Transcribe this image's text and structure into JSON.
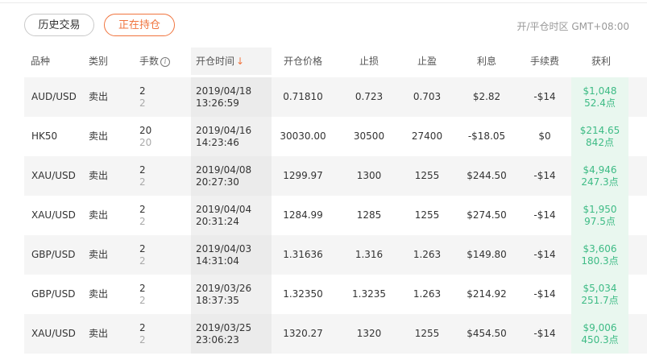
{
  "tabs": {
    "history": "历史交易",
    "open": "正在持仓"
  },
  "timezone": "开/平仓时区 GMT+08:00",
  "headers": {
    "symbol": "品种",
    "type": "类别",
    "lots": "手数",
    "open_time": "开仓时间",
    "open_price": "开仓价格",
    "stop_loss": "止损",
    "take_profit": "止盈",
    "interest": "利息",
    "commission": "手续费",
    "profit": "获利"
  },
  "colors": {
    "accent": "#f0743e",
    "profit": "#3dbb85"
  },
  "rows": [
    {
      "symbol": "AUD/USD",
      "type": "卖出",
      "lots": "2",
      "lots_sub": "2",
      "date": "2019/04/18",
      "time": "13:26:59",
      "open_price": "0.71810",
      "stop_loss": "0.723",
      "take_profit": "0.703",
      "interest": "$2.82",
      "commission": "-$14",
      "profit": "$1,048",
      "points": "52.4点"
    },
    {
      "symbol": "HK50",
      "type": "卖出",
      "lots": "20",
      "lots_sub": "20",
      "date": "2019/04/16",
      "time": "14:23:46",
      "open_price": "30030.00",
      "stop_loss": "30500",
      "take_profit": "27400",
      "interest": "-$18.05",
      "commission": "$0",
      "profit": "$214.65",
      "points": "842点"
    },
    {
      "symbol": "XAU/USD",
      "type": "卖出",
      "lots": "2",
      "lots_sub": "2",
      "date": "2019/04/08",
      "time": "20:27:30",
      "open_price": "1299.97",
      "stop_loss": "1300",
      "take_profit": "1255",
      "interest": "$244.50",
      "commission": "-$14",
      "profit": "$4,946",
      "points": "247.3点"
    },
    {
      "symbol": "XAU/USD",
      "type": "卖出",
      "lots": "2",
      "lots_sub": "2",
      "date": "2019/04/04",
      "time": "20:31:24",
      "open_price": "1284.99",
      "stop_loss": "1285",
      "take_profit": "1255",
      "interest": "$274.50",
      "commission": "-$14",
      "profit": "$1,950",
      "points": "97.5点"
    },
    {
      "symbol": "GBP/USD",
      "type": "卖出",
      "lots": "2",
      "lots_sub": "2",
      "date": "2019/04/03",
      "time": "14:31:04",
      "open_price": "1.31636",
      "stop_loss": "1.316",
      "take_profit": "1.263",
      "interest": "$149.80",
      "commission": "-$14",
      "profit": "$3,606",
      "points": "180.3点"
    },
    {
      "symbol": "GBP/USD",
      "type": "卖出",
      "lots": "2",
      "lots_sub": "2",
      "date": "2019/03/26",
      "time": "18:37:35",
      "open_price": "1.32350",
      "stop_loss": "1.3235",
      "take_profit": "1.263",
      "interest": "$214.92",
      "commission": "-$14",
      "profit": "$5,034",
      "points": "251.7点"
    },
    {
      "symbol": "XAU/USD",
      "type": "卖出",
      "lots": "2",
      "lots_sub": "2",
      "date": "2019/03/25",
      "time": "23:06:23",
      "open_price": "1320.27",
      "stop_loss": "1320",
      "take_profit": "1255",
      "interest": "$454.50",
      "commission": "-$14",
      "profit": "$9,006",
      "points": "450.3点"
    }
  ]
}
